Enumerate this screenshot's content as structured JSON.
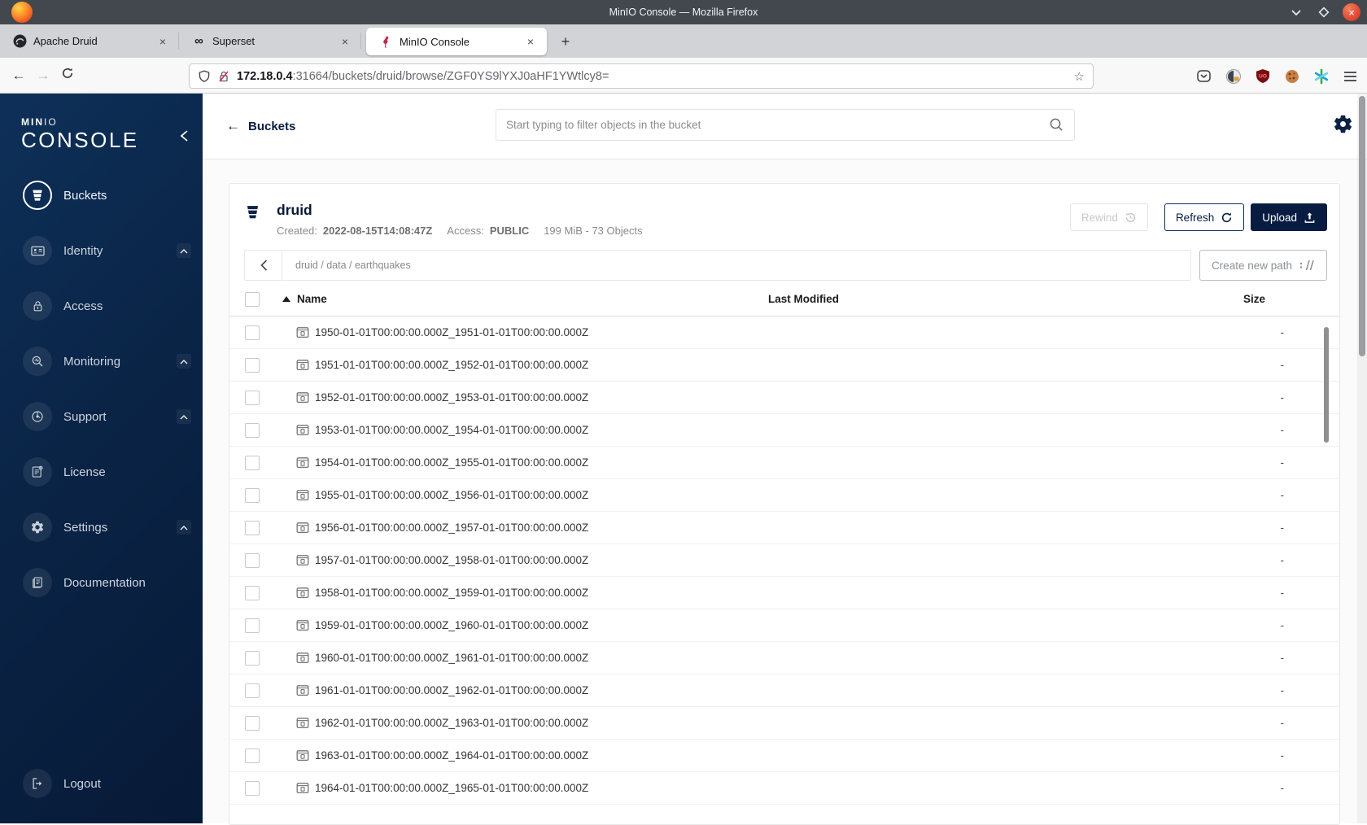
{
  "browser": {
    "title": "MinIO Console — Mozilla Firefox",
    "tabs": [
      {
        "title": "Apache Druid"
      },
      {
        "title": "Superset"
      },
      {
        "title": "MinIO Console"
      }
    ],
    "url_host": "172.18.0.4",
    "url_rest": ":31664/buckets/druid/browse/ZGF0YS9lYXJ0aHF1YWtlcy8="
  },
  "icons": {
    "tab_close": "×",
    "new_tab": "+",
    "back": "←",
    "forward": "→",
    "star": "☆",
    "superset": "∞",
    "ublock_text": "UO",
    "close_window": "×"
  },
  "sidebar": {
    "logo_part1": "MIN",
    "logo_part2": "IO",
    "logo_line2": "CONSOLE",
    "items": [
      {
        "label": "Buckets"
      },
      {
        "label": "Identity"
      },
      {
        "label": "Access"
      },
      {
        "label": "Monitoring"
      },
      {
        "label": "Support"
      },
      {
        "label": "License"
      },
      {
        "label": "Settings"
      },
      {
        "label": "Documentation"
      }
    ],
    "logout_label": "Logout"
  },
  "header": {
    "back_label": "Buckets",
    "search_placeholder": "Start typing to filter objects in the bucket"
  },
  "bucket": {
    "name": "druid",
    "created_label": "Created:",
    "created_value": "2022-08-15T14:08:47Z",
    "access_label": "Access:",
    "access_value": "PUBLIC",
    "summary": "199 MiB - 73 Objects",
    "rewind_label": "Rewind",
    "refresh_label": "Refresh",
    "upload_label": "Upload"
  },
  "browse": {
    "breadcrumb": "druid / data / earthquakes",
    "create_path_label": "Create new path"
  },
  "table": {
    "columns": {
      "name": "Name",
      "last_modified": "Last Modified",
      "size": "Size"
    },
    "rows": [
      {
        "name": "1950-01-01T00:00:00.000Z_1951-01-01T00:00:00.000Z",
        "size": "-"
      },
      {
        "name": "1951-01-01T00:00:00.000Z_1952-01-01T00:00:00.000Z",
        "size": "-"
      },
      {
        "name": "1952-01-01T00:00:00.000Z_1953-01-01T00:00:00.000Z",
        "size": "-"
      },
      {
        "name": "1953-01-01T00:00:00.000Z_1954-01-01T00:00:00.000Z",
        "size": "-"
      },
      {
        "name": "1954-01-01T00:00:00.000Z_1955-01-01T00:00:00.000Z",
        "size": "-"
      },
      {
        "name": "1955-01-01T00:00:00.000Z_1956-01-01T00:00:00.000Z",
        "size": "-"
      },
      {
        "name": "1956-01-01T00:00:00.000Z_1957-01-01T00:00:00.000Z",
        "size": "-"
      },
      {
        "name": "1957-01-01T00:00:00.000Z_1958-01-01T00:00:00.000Z",
        "size": "-"
      },
      {
        "name": "1958-01-01T00:00:00.000Z_1959-01-01T00:00:00.000Z",
        "size": "-"
      },
      {
        "name": "1959-01-01T00:00:00.000Z_1960-01-01T00:00:00.000Z",
        "size": "-"
      },
      {
        "name": "1960-01-01T00:00:00.000Z_1961-01-01T00:00:00.000Z",
        "size": "-"
      },
      {
        "name": "1961-01-01T00:00:00.000Z_1962-01-01T00:00:00.000Z",
        "size": "-"
      },
      {
        "name": "1962-01-01T00:00:00.000Z_1963-01-01T00:00:00.000Z",
        "size": "-"
      },
      {
        "name": "1963-01-01T00:00:00.000Z_1964-01-01T00:00:00.000Z",
        "size": "-"
      },
      {
        "name": "1964-01-01T00:00:00.000Z_1965-01-01T00:00:00.000Z",
        "size": "-"
      }
    ]
  },
  "colors": {
    "accent": "#081c42",
    "flamingo": "#c7264a"
  }
}
